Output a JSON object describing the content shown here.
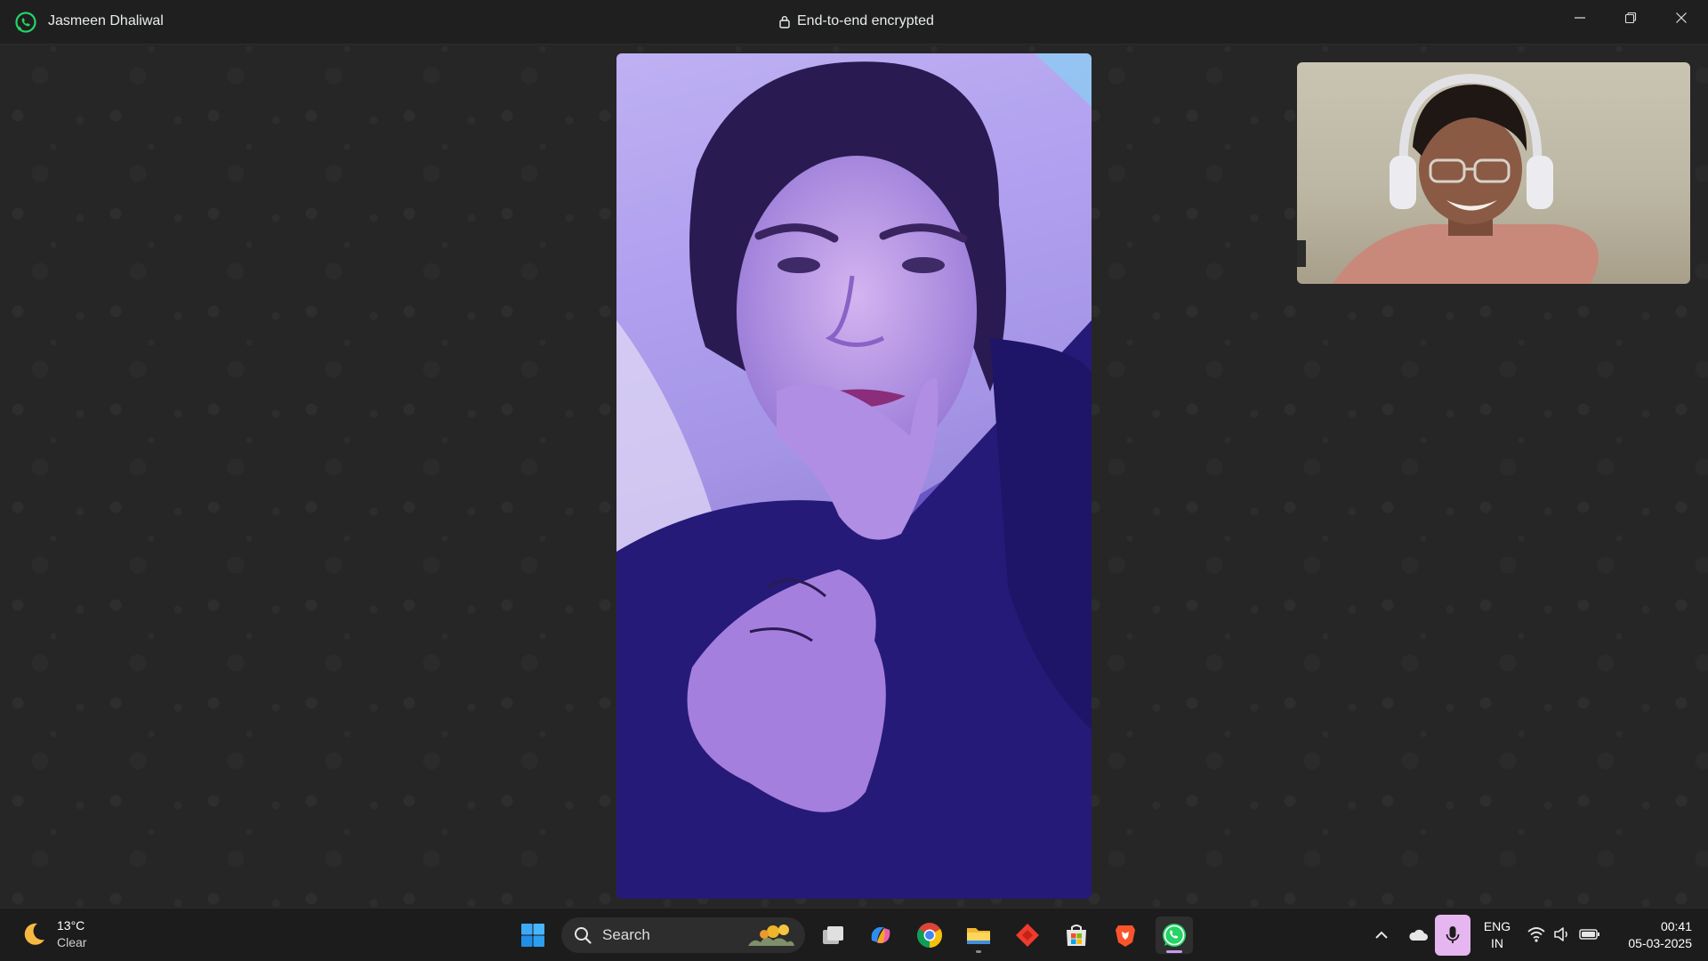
{
  "window": {
    "contact_name": "Jasmeen Dhaliwal",
    "encryption_label": "End-to-end encrypted",
    "controls": [
      "minimize-icon",
      "restore-icon",
      "close-icon"
    ],
    "brand_color": "#25d366"
  },
  "call": {
    "remote_video": "video-feed",
    "self_video": "video-feed"
  },
  "taskbar": {
    "weather": {
      "temperature": "13°C",
      "condition": "Clear",
      "icon": "moon-icon"
    },
    "search": {
      "label": "Search"
    },
    "pinned_apps": [
      {
        "name": "start",
        "icon": "windows-logo-icon"
      },
      {
        "name": "task-view",
        "icon": "task-view-icon"
      },
      {
        "name": "copilot",
        "icon": "copilot-icon"
      },
      {
        "name": "chrome",
        "icon": "chrome-icon"
      },
      {
        "name": "file-explorer",
        "icon": "folder-icon"
      },
      {
        "name": "anydesk",
        "icon": "anydesk-icon"
      },
      {
        "name": "microsoft-store",
        "icon": "store-icon"
      },
      {
        "name": "brave",
        "icon": "brave-icon"
      },
      {
        "name": "whatsapp",
        "icon": "whatsapp-icon",
        "active": true
      }
    ],
    "tray": {
      "language_line1": "ENG",
      "language_line2": "IN",
      "time": "00:41",
      "date": "05-03-2025",
      "mic_active_color": "#e6b6f0"
    }
  }
}
